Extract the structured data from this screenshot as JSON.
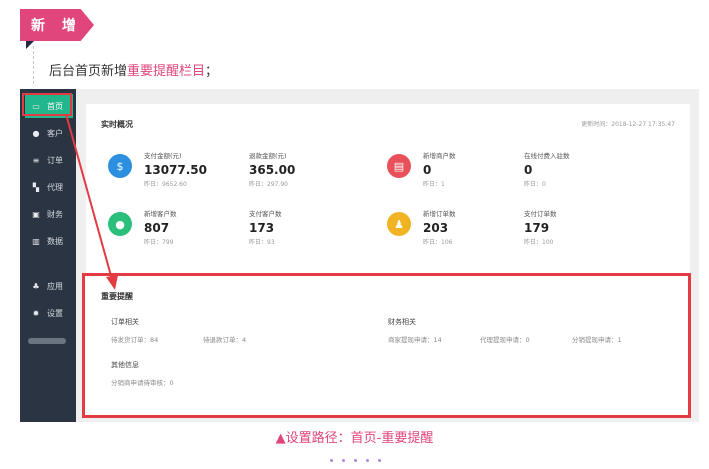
{
  "header": {
    "tag_label": "新 增",
    "intro_prefix": "后台首页新增",
    "intro_highlight": "重要提醒栏目",
    "intro_suffix": "；"
  },
  "sidebar": {
    "items": [
      {
        "icon": "monitor-icon",
        "label": "首页"
      },
      {
        "icon": "user-icon",
        "label": "客户"
      },
      {
        "icon": "list-icon",
        "label": "订单"
      },
      {
        "icon": "flag-icon",
        "label": "代理"
      },
      {
        "icon": "wallet-icon",
        "label": "财务"
      },
      {
        "icon": "bar-chart-icon",
        "label": "数据"
      },
      {
        "icon": "apps-icon",
        "label": "应用"
      },
      {
        "icon": "gear-icon",
        "label": "设置"
      }
    ]
  },
  "overview": {
    "title": "实时概况",
    "update_time": "更新时间：2018-12-27 17:35:47",
    "stats": [
      {
        "label": "支付金额(元)",
        "value": "13077.50",
        "prev": "昨日：9652.60"
      },
      {
        "label": "退款金额(元)",
        "value": "365.00",
        "prev": "昨日：297.90"
      },
      {
        "label": "新增商户数",
        "value": "0",
        "prev": "昨日：1"
      },
      {
        "label": "在线付费入驻数",
        "value": "0",
        "prev": "昨日：0"
      },
      {
        "label": "新增客户数",
        "value": "807",
        "prev": "昨日：799"
      },
      {
        "label": "支付客户数",
        "value": "173",
        "prev": "昨日：93"
      },
      {
        "label": "新增订单数",
        "value": "203",
        "prev": "昨日：106"
      },
      {
        "label": "支付订单数",
        "value": "179",
        "prev": "昨日：100"
      }
    ]
  },
  "reminder": {
    "title": "重要提醒",
    "order": {
      "title": "订单相关",
      "items": [
        "待发货订单：84",
        "待退款订单：4"
      ]
    },
    "finance": {
      "title": "财务相关",
      "items": [
        "商家提现申请：14",
        "代理提现申请：0",
        "分销提现申请：1"
      ]
    },
    "other": {
      "title": "其他信息",
      "items": [
        "分销商申请待审核：0"
      ]
    }
  },
  "caption": "▲设置路径：首页-重要提醒",
  "colors": {
    "accent": "#e0457b",
    "highlight": "#e23b43",
    "sidebar": "#2b3442",
    "active": "#21b68b"
  }
}
